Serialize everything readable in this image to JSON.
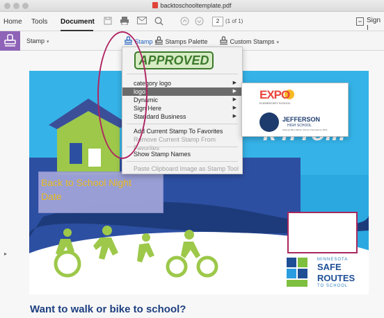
{
  "window": {
    "title": "backtoschooltemplate.pdf"
  },
  "toolbar": {
    "tabs": [
      "Home",
      "Tools",
      "Document"
    ],
    "active_tab": "Document",
    "page_number": "2",
    "page_of": "(1 of 1)",
    "sign_label": "Sign I"
  },
  "stamp_bar": {
    "stamp_label": "Stamp",
    "stamp_blue_label": "Stamp",
    "palette_label": "Stamps Palette",
    "custom_label": "Custom Stamps"
  },
  "stamp_menu": {
    "preview": "APPROVED",
    "items": [
      "category logo",
      "logo",
      "Dynamic",
      "Sign Here",
      "Standard Business",
      "Add Current Stamp To Favorites",
      "Remove Current Stamp From Favorites",
      "Show Stamp Names",
      "Paste Clipboard Image as Stamp Tool"
    ],
    "highlighted": "logo"
  },
  "submenu": {
    "logo1_text": "EXPO",
    "logo1_sub": "ELEMENTARY SCHOOL",
    "logo2_name": "JEFFERSON",
    "logo2_sub": "HIGH SCHOOL",
    "logo2_tiny": "National Blue Ribbon School of Excellence 2016"
  },
  "flyer": {
    "slogan_tail": "k'n'roll!",
    "event_line1": "Back to School Night",
    "event_line2": "Date",
    "srts_state": "MINNESOTA",
    "srts_safe": "SAFE",
    "srts_routes": "ROUTES",
    "srts_to": "TO SCHOOL",
    "heading": "Want to walk or bike to school?"
  },
  "colors": {
    "sky": "#2ba8e0",
    "ground": "#2d4fa2",
    "event_text": "#f4c21a",
    "annotation": "#b02463",
    "approved_green": "#3d7a2c",
    "stamp_tool_accent": "#8f63b8"
  }
}
